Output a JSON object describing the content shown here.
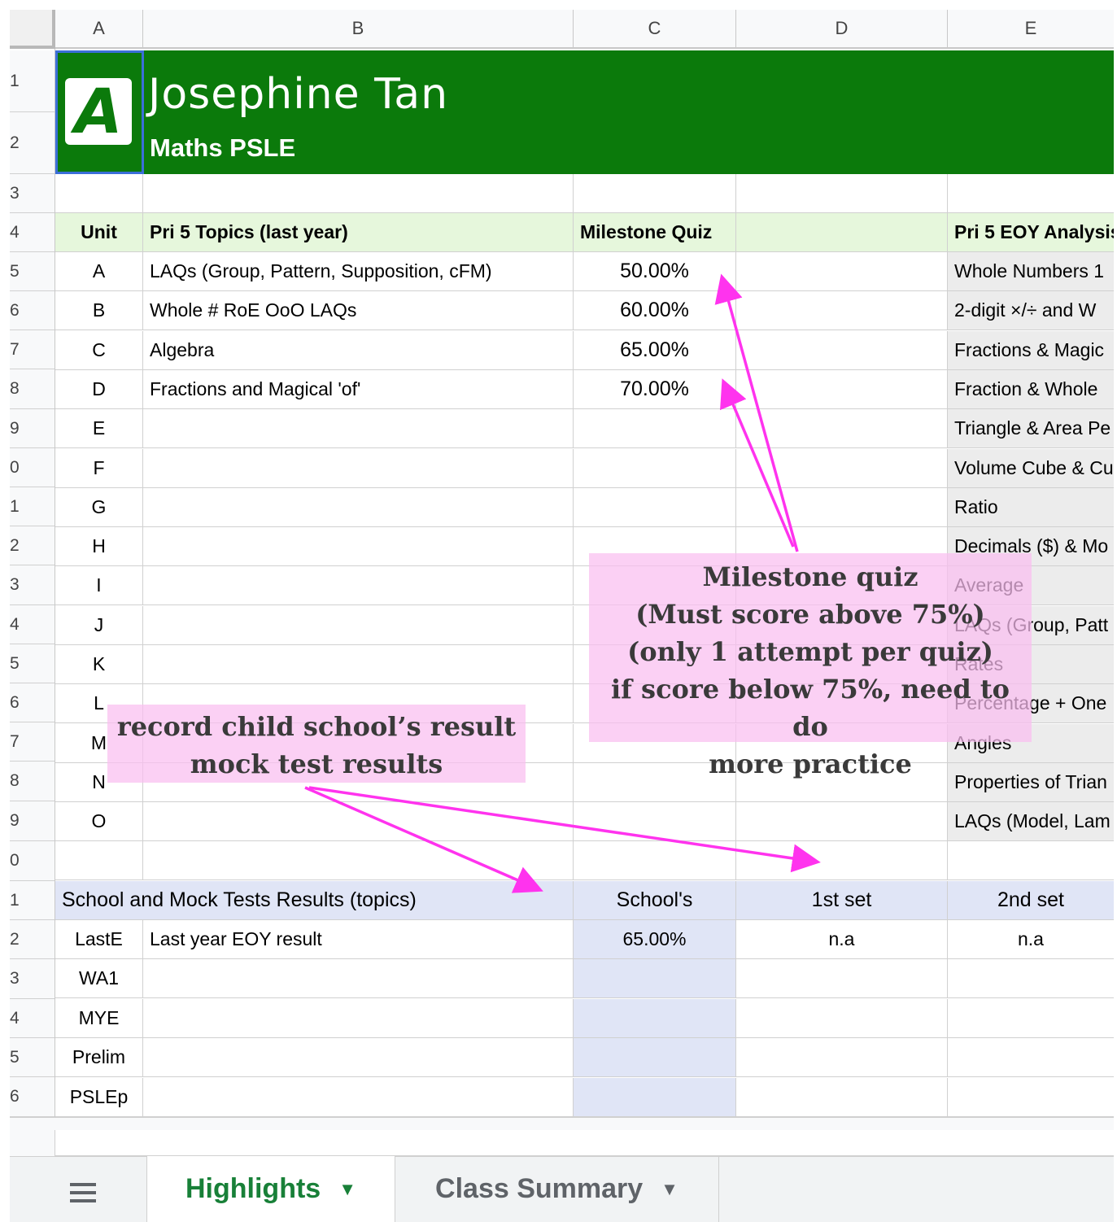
{
  "columns": [
    "A",
    "B",
    "C",
    "D",
    "E"
  ],
  "row_numbers": [
    "1",
    "2",
    "3",
    "4",
    "5",
    "6",
    "7",
    "8",
    "9",
    "0",
    "1",
    "2",
    "3",
    "4",
    "5",
    "6",
    "7",
    "8",
    "9",
    "0",
    "1",
    "2",
    "3",
    "4",
    "5",
    "6"
  ],
  "banner": {
    "logo_letter": "A",
    "name": "Josephine Tan",
    "subtitle": "Maths PSLE",
    "color": "#0b7a0b"
  },
  "topics_table": {
    "headers": {
      "unit": "Unit",
      "topics": "Pri 5 Topics (last year)",
      "quiz": "Milestone Quiz",
      "analysis": "Pri 5 EOY Analysis"
    },
    "rows": [
      {
        "unit": "A",
        "topic": "LAQs (Group, Pattern, Supposition, cFM)",
        "quiz": "50.00%",
        "analysis": "Whole Numbers 1"
      },
      {
        "unit": "B",
        "topic": "Whole # RoE OoO LAQs",
        "quiz": "60.00%",
        "analysis": "2-digit ×/÷ and W"
      },
      {
        "unit": "C",
        "topic": "Algebra",
        "quiz": "65.00%",
        "analysis": "Fractions & Magic"
      },
      {
        "unit": "D",
        "topic": "Fractions and Magical 'of'",
        "quiz": "70.00%",
        "analysis": "Fraction & Whole"
      },
      {
        "unit": "E",
        "topic": "",
        "quiz": "",
        "analysis": "Triangle & Area Pe"
      },
      {
        "unit": "F",
        "topic": "",
        "quiz": "",
        "analysis": "Volume Cube & Cu"
      },
      {
        "unit": "G",
        "topic": "",
        "quiz": "",
        "analysis": "Ratio"
      },
      {
        "unit": "H",
        "topic": "",
        "quiz": "",
        "analysis": "Decimals ($) & Mo"
      },
      {
        "unit": "I",
        "topic": "",
        "quiz": "",
        "analysis": "Average"
      },
      {
        "unit": "J",
        "topic": "",
        "quiz": "",
        "analysis": "LAQs (Group, Patt"
      },
      {
        "unit": "K",
        "topic": "",
        "quiz": "",
        "analysis": "Rates"
      },
      {
        "unit": "L",
        "topic": "",
        "quiz": "",
        "analysis": "Percentage + One"
      },
      {
        "unit": "M",
        "topic": "",
        "quiz": "",
        "analysis": "Angles"
      },
      {
        "unit": "N",
        "topic": "",
        "quiz": "",
        "analysis": "Properties of Trian"
      },
      {
        "unit": "O",
        "topic": "",
        "quiz": "",
        "analysis": "LAQs (Model, Lam"
      }
    ]
  },
  "results_table": {
    "headers": {
      "title": "School and Mock Tests Results (topics)",
      "school": "School's",
      "set1": "1st set",
      "set2": "2nd set"
    },
    "rows": [
      {
        "code": "LastE",
        "desc": "Last year EOY result",
        "school": "65.00%",
        "set1": "n.a",
        "set2": "n.a"
      },
      {
        "code": "WA1",
        "desc": "",
        "school": "",
        "set1": "",
        "set2": ""
      },
      {
        "code": "MYE",
        "desc": "",
        "school": "",
        "set1": "",
        "set2": ""
      },
      {
        "code": "Prelim",
        "desc": "",
        "school": "",
        "set1": "",
        "set2": ""
      },
      {
        "code": "PSLEp",
        "desc": "",
        "school": "",
        "set1": "",
        "set2": ""
      }
    ]
  },
  "annotations": {
    "milestone": [
      "Milestone quiz",
      "(Must score above 75%)",
      "(only 1 attempt per quiz)",
      "if score below 75%, need to do",
      "more practice"
    ],
    "school": [
      "record child school’s result",
      "mock test results"
    ],
    "arrow_color": "#ff33ee"
  },
  "sheet_tabs": {
    "active": "Highlights",
    "other": "Class Summary"
  },
  "colors": {
    "header_green_light": "#e6f7dc",
    "header_blue_light": "#e0e5f6",
    "analysis_grey": "#ececec"
  }
}
